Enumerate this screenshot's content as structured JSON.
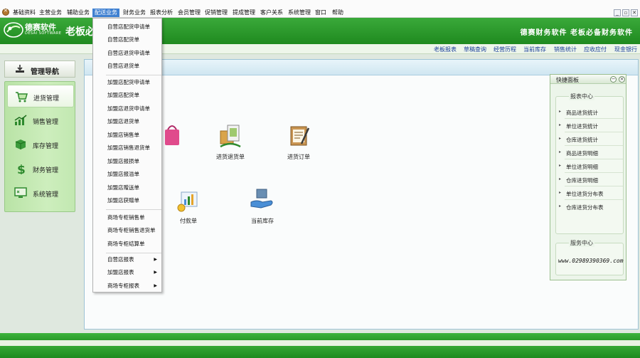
{
  "menubar": {
    "items": [
      "基础资料",
      "主营业务",
      "辅助业务",
      "配送业务",
      "财务业务",
      "报表分析",
      "会员管理",
      "促销管理",
      "提成管理",
      "客户关系",
      "系统管理",
      "窗口",
      "帮助"
    ],
    "active_index": 3
  },
  "window_controls": {
    "minimize": "_",
    "restore": "▫",
    "close": "✕"
  },
  "banner": {
    "brand_cn": "德赛软件",
    "brand_en": "DESAI SOFTWARE",
    "slogan": "老板必",
    "right_text": "德赛财务软件  老板必备财务软件"
  },
  "quick_links": [
    "老板报表",
    "草稿查询",
    "经营历程",
    "当前库存",
    "销售统计",
    "应收应付",
    "现金银行"
  ],
  "nav": {
    "title": "管理导航",
    "items": [
      "进货管理",
      "销售管理",
      "库存管理",
      "财务管理",
      "系统管理"
    ],
    "active_index": 0
  },
  "tiles": {
    "purchase_return": "进货退货单",
    "purchase_order": "进货订单",
    "payment": "付款单",
    "current_stock": "当前库存"
  },
  "quick_panel": {
    "title": "快捷面板",
    "report_center": "报表中心",
    "report_links": [
      "商品进货统计",
      "单位进货统计",
      "仓库进货统计",
      "商品进货明细",
      "单位进货明细",
      "仓库进货明细",
      "单位进货分布表",
      "仓库进货分布表"
    ],
    "service_center": "服务中心",
    "service_phone": "www.02989390369.com"
  },
  "dropdown": {
    "group1": [
      "自营店配货申请单",
      "自营店配货单",
      "自营店退货申请单",
      "自营店退货单"
    ],
    "group2": [
      "加盟店配货申请单",
      "加盟店配货单",
      "加盟店退货申请单",
      "加盟店退货单",
      "加盟店销售单",
      "加盟店销售退货单",
      "加盟店报损单",
      "加盟店报溢单",
      "加盟店赠送单",
      "加盟店获赠单"
    ],
    "group3": [
      "商场专柜销售单",
      "商场专柜销售退货单",
      "商场专柜结算单"
    ],
    "group4": [
      "自营店报表",
      "加盟店报表",
      "商场专柜报表"
    ]
  },
  "colors": {
    "brand_green": "#2a9b2a",
    "menu_active": "#3f80d1",
    "link_blue": "#1a3f9a"
  }
}
